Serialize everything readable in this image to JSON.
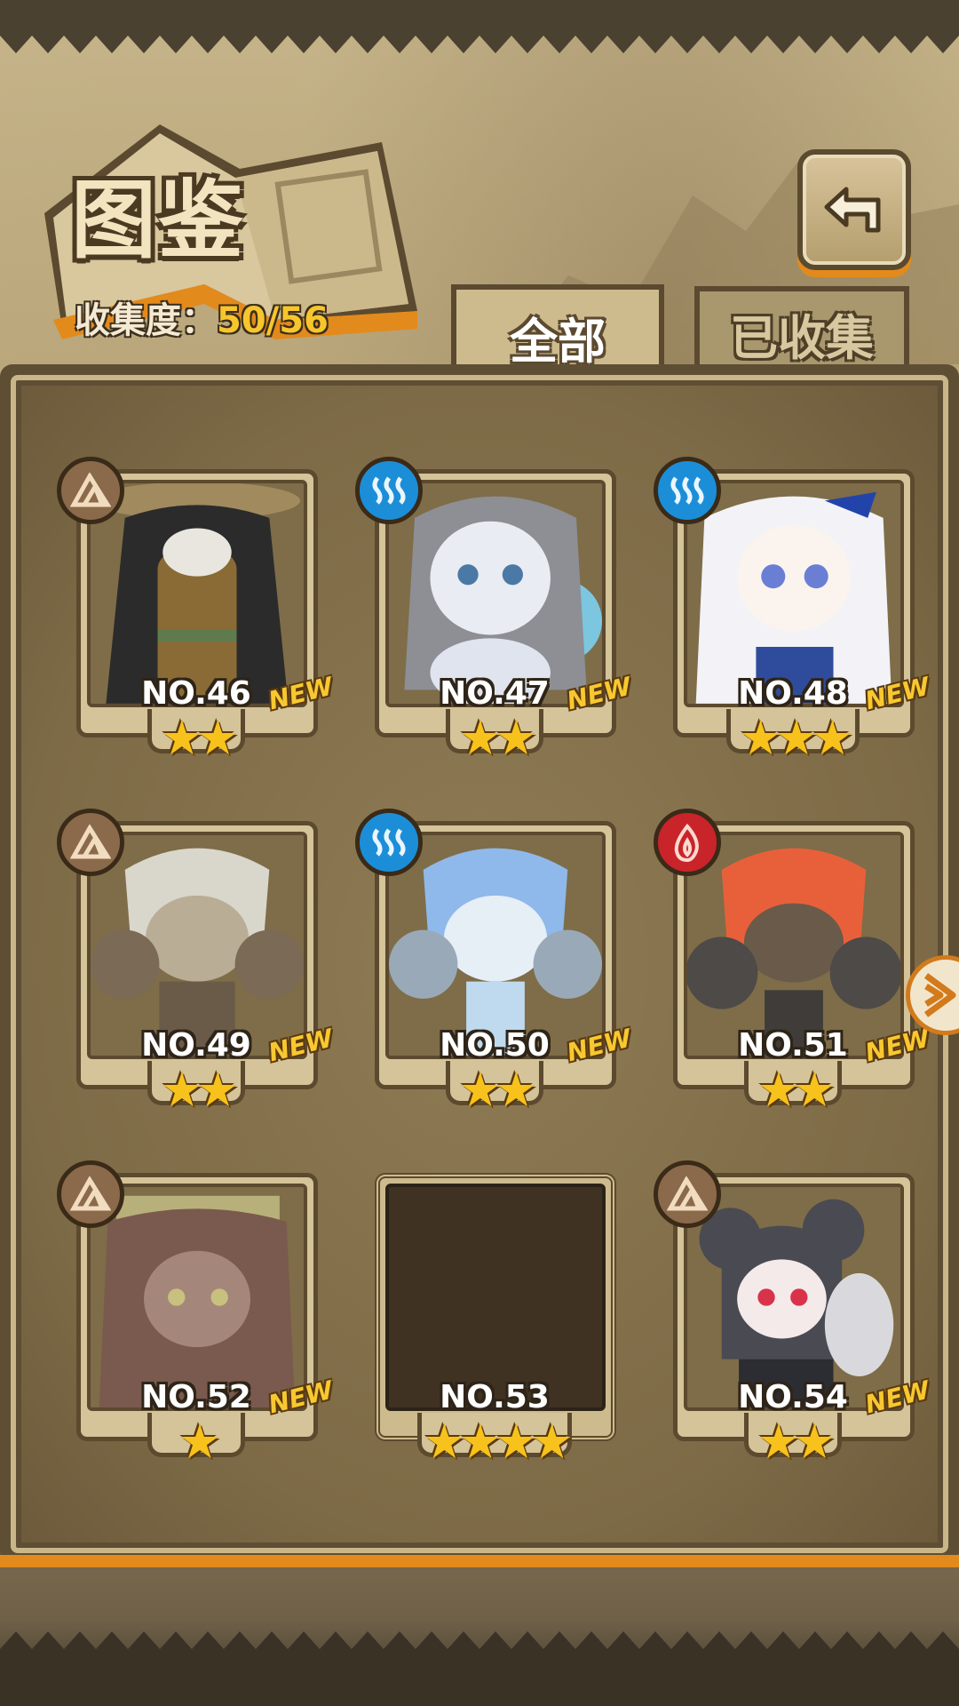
{
  "header": {
    "title": "图鉴",
    "collection_label": "收集度：",
    "collection_value": "50/56"
  },
  "tabs": [
    {
      "label": "全部",
      "active": true
    },
    {
      "label": "已收集",
      "active": false
    }
  ],
  "cards": [
    {
      "number": "NO.46",
      "element": "earth",
      "stars": "★★",
      "new": "NEW",
      "palette": [
        "#2b2b2b",
        "#8a6b35"
      ]
    },
    {
      "number": "NO.47",
      "element": "water",
      "stars": "★★",
      "new": "NEW",
      "palette": [
        "#8d8f95",
        "#7cc6e0"
      ]
    },
    {
      "number": "NO.48",
      "element": "water",
      "stars": "★★★",
      "new": "NEW",
      "palette": [
        "#f2f2f7",
        "#9fb4e6"
      ]
    },
    {
      "number": "NO.49",
      "element": "earth",
      "stars": "★★",
      "new": "NEW",
      "palette": [
        "#d9d6cc",
        "#7b6a55"
      ]
    },
    {
      "number": "NO.50",
      "element": "water",
      "stars": "★★",
      "new": "NEW",
      "palette": [
        "#8fb9ea",
        "#9aa9b7"
      ]
    },
    {
      "number": "NO.51",
      "element": "fire",
      "stars": "★★",
      "new": "NEW",
      "palette": [
        "#e8603a",
        "#4d4a47"
      ]
    },
    {
      "number": "NO.52",
      "element": "earth",
      "stars": "★",
      "new": "NEW",
      "palette": [
        "#7a5a4e",
        "#a5867a"
      ]
    },
    {
      "number": "NO.53",
      "element": "",
      "stars": "★★★★",
      "new": "",
      "locked": true,
      "palette": [
        "#3f3223",
        "#3f3223"
      ]
    },
    {
      "number": "NO.54",
      "element": "earth",
      "stars": "★★",
      "new": "NEW",
      "palette": [
        "#4a4a52",
        "#d9d9dd"
      ]
    }
  ],
  "colors": {
    "accent_orange": "#e38a1c",
    "star_gold": "#f8c21c",
    "earth": "#8a6a4a",
    "water": "#1c8ed8",
    "fire": "#c8242a"
  },
  "icons": {
    "back": "return-arrow-icon",
    "side": "next-page-arrow-icon"
  }
}
